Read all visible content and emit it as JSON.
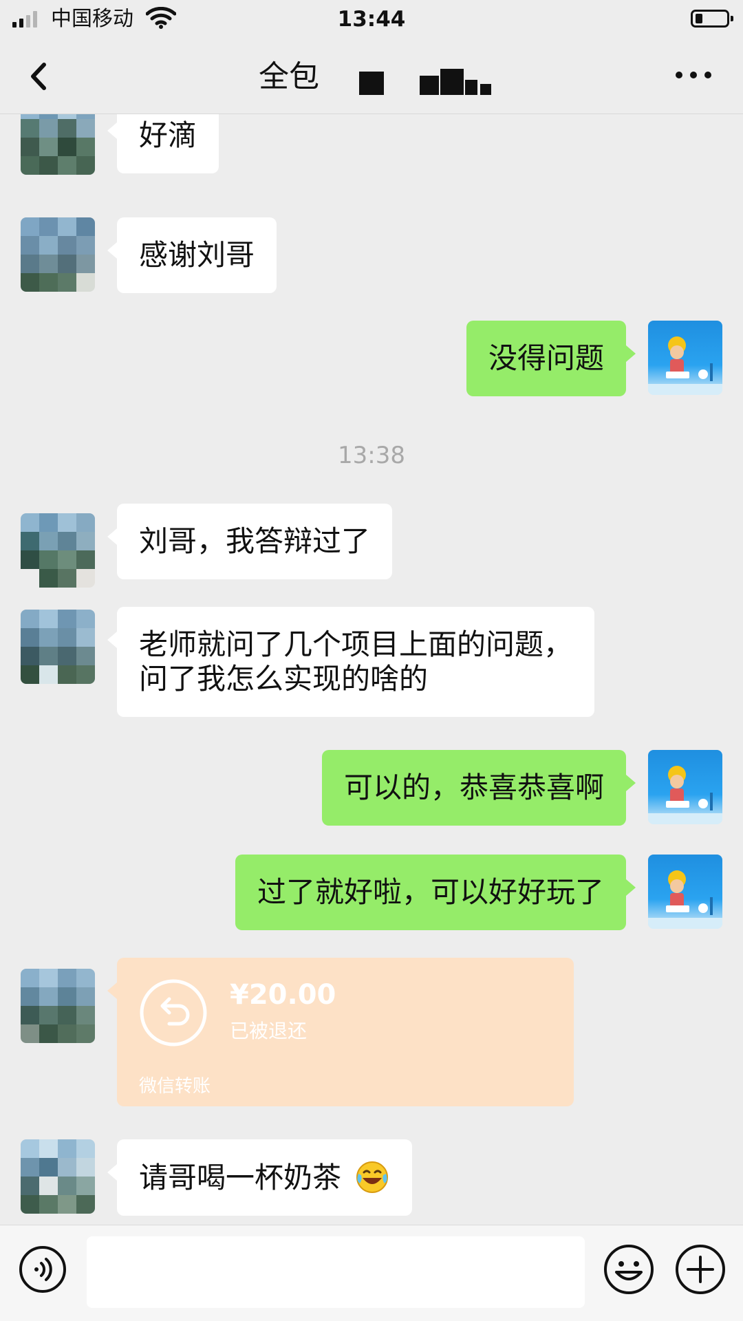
{
  "status_bar": {
    "carrier": "中国移动",
    "time": "13:44"
  },
  "header": {
    "title": "全包"
  },
  "messages": [
    {
      "side": "left",
      "text": "好滴"
    },
    {
      "side": "left",
      "text": "感谢刘哥"
    },
    {
      "side": "right",
      "text": "没得问题"
    },
    {
      "side": "left",
      "text": "刘哥，我答辩过了"
    },
    {
      "side": "left",
      "lines": [
        "老师就问了几个项目上面的问题，",
        "问了我怎么实现的啥的"
      ]
    },
    {
      "side": "right",
      "text": "可以的，恭喜恭喜啊"
    },
    {
      "side": "right",
      "text": "过了就好啦，可以好好玩了"
    },
    {
      "side": "left",
      "text": "请哥喝一杯奶茶"
    }
  ],
  "timestamp": "13:38",
  "transfer": {
    "amount": "¥20.00",
    "status": "已被退还",
    "brand": "微信转账"
  },
  "icons": {
    "back": "back-arrow-icon",
    "more": "more-icon",
    "voice": "voice-icon",
    "emoji": "emoji-icon",
    "plus": "plus-icon",
    "transfer": "refund-arrow-icon",
    "laughing": "laughing-emoji-icon"
  },
  "colors": {
    "sent_bubble": "#95ec69",
    "received_bubble": "#ffffff",
    "background": "#ededed",
    "transfer_card": "#fde1c6"
  }
}
